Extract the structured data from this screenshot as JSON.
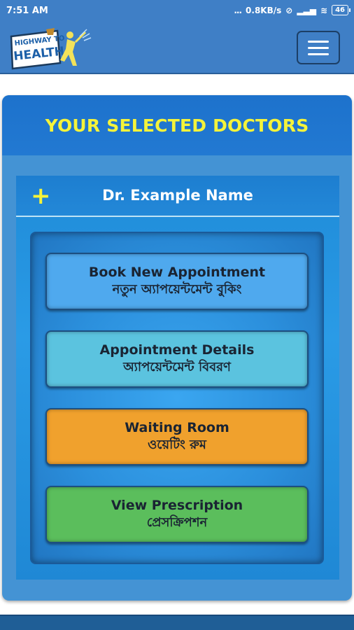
{
  "status": {
    "time": "7:51 AM",
    "dots": "...",
    "speed": "0.8KB/s",
    "mute_icon": "⊘",
    "signal_icon": "▂▃▅",
    "wifi_icon": "≋",
    "battery": "46"
  },
  "appbar": {
    "logo_line1": "HIGHWAY TO",
    "logo_line2": "HEALTH"
  },
  "card": {
    "title": "YOUR SELECTED DOCTORS",
    "plus_icon": "+",
    "doctor_name": "Dr. Example Name"
  },
  "buttons": {
    "book": {
      "en": "Book New Appointment",
      "bn": "নতুন অ্যাপয়েন্টমেন্ট বুকিং"
    },
    "details": {
      "en": "Appointment Details",
      "bn": "অ্যাপয়েন্টমেন্ট বিবরণ"
    },
    "waiting": {
      "en": "Waiting Room",
      "bn": "ওয়েটিং রুম"
    },
    "prescription": {
      "en": "View Prescription",
      "bn": "প্রেসক্রিপশন"
    }
  },
  "colors": {
    "primary": "#3f7fc6",
    "title_yellow": "#f4f33a",
    "book": "#4fa9ee",
    "details": "#5bc3df",
    "waiting": "#f0a12d",
    "prescription": "#5bbe5c"
  }
}
